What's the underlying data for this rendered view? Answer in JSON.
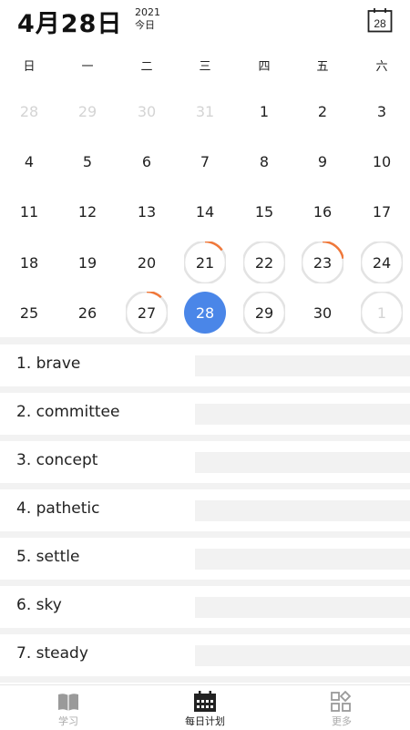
{
  "header": {
    "date_title": "4月28日",
    "year": "2021",
    "today_label": "今日",
    "calendar_icon_number": "28"
  },
  "weekdays": [
    "日",
    "一",
    "二",
    "三",
    "四",
    "五",
    "六"
  ],
  "calendar": {
    "weeks": [
      [
        {
          "d": "28",
          "dim": true
        },
        {
          "d": "29",
          "dim": true
        },
        {
          "d": "30",
          "dim": true
        },
        {
          "d": "31",
          "dim": true
        },
        {
          "d": "1"
        },
        {
          "d": "2"
        },
        {
          "d": "3"
        }
      ],
      [
        {
          "d": "4"
        },
        {
          "d": "5"
        },
        {
          "d": "6"
        },
        {
          "d": "7"
        },
        {
          "d": "8"
        },
        {
          "d": "9"
        },
        {
          "d": "10"
        }
      ],
      [
        {
          "d": "11"
        },
        {
          "d": "12"
        },
        {
          "d": "13"
        },
        {
          "d": "14"
        },
        {
          "d": "15"
        },
        {
          "d": "16"
        },
        {
          "d": "17"
        }
      ],
      [
        {
          "d": "18"
        },
        {
          "d": "19"
        },
        {
          "d": "20"
        },
        {
          "d": "21",
          "progress": 0.15
        },
        {
          "d": "22",
          "progress": 0
        },
        {
          "d": "23",
          "progress": 0.22
        },
        {
          "d": "24",
          "progress": 0
        }
      ],
      [
        {
          "d": "25"
        },
        {
          "d": "26"
        },
        {
          "d": "27",
          "progress": 0.12
        },
        {
          "d": "28",
          "today": true
        },
        {
          "d": "29",
          "progress": 0
        },
        {
          "d": "30"
        },
        {
          "d": "1",
          "dim": true,
          "progress": 0
        }
      ]
    ],
    "today_color": "#4a86e8",
    "progress_color": "#f0783a",
    "ring_color": "#e3e3e3"
  },
  "words": [
    {
      "label": "1. brave"
    },
    {
      "label": "2. committee"
    },
    {
      "label": "3. concept"
    },
    {
      "label": "4. pathetic"
    },
    {
      "label": "5. settle"
    },
    {
      "label": "6. sky"
    },
    {
      "label": "7. steady"
    }
  ],
  "tabs": [
    {
      "label": "学习",
      "icon": "book-icon",
      "active": false
    },
    {
      "label": "每日计划",
      "icon": "calendar-icon",
      "active": true
    },
    {
      "label": "更多",
      "icon": "grid-icon",
      "active": false
    }
  ]
}
